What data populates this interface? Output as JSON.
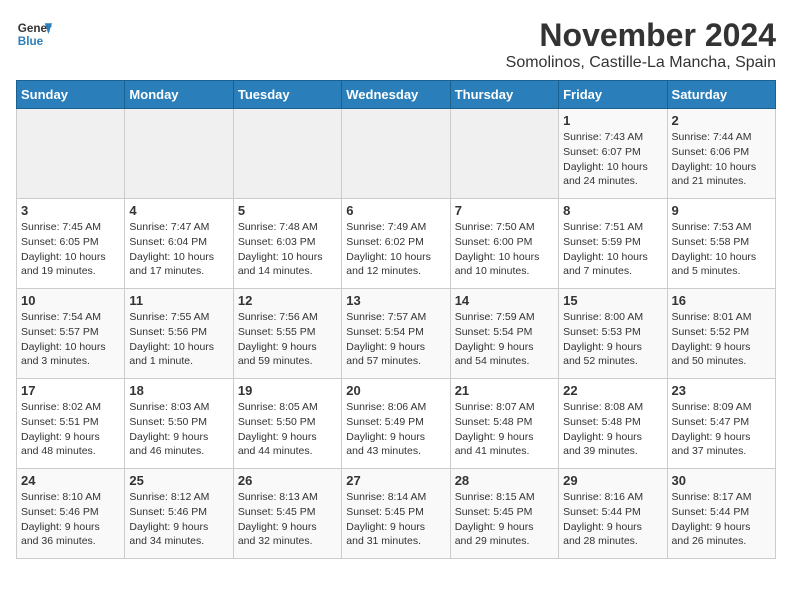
{
  "header": {
    "logo_general": "General",
    "logo_blue": "Blue",
    "month": "November 2024",
    "location": "Somolinos, Castille-La Mancha, Spain"
  },
  "weekdays": [
    "Sunday",
    "Monday",
    "Tuesday",
    "Wednesday",
    "Thursday",
    "Friday",
    "Saturday"
  ],
  "weeks": [
    [
      {
        "day": "",
        "info": ""
      },
      {
        "day": "",
        "info": ""
      },
      {
        "day": "",
        "info": ""
      },
      {
        "day": "",
        "info": ""
      },
      {
        "day": "",
        "info": ""
      },
      {
        "day": "1",
        "info": "Sunrise: 7:43 AM\nSunset: 6:07 PM\nDaylight: 10 hours\nand 24 minutes."
      },
      {
        "day": "2",
        "info": "Sunrise: 7:44 AM\nSunset: 6:06 PM\nDaylight: 10 hours\nand 21 minutes."
      }
    ],
    [
      {
        "day": "3",
        "info": "Sunrise: 7:45 AM\nSunset: 6:05 PM\nDaylight: 10 hours\nand 19 minutes."
      },
      {
        "day": "4",
        "info": "Sunrise: 7:47 AM\nSunset: 6:04 PM\nDaylight: 10 hours\nand 17 minutes."
      },
      {
        "day": "5",
        "info": "Sunrise: 7:48 AM\nSunset: 6:03 PM\nDaylight: 10 hours\nand 14 minutes."
      },
      {
        "day": "6",
        "info": "Sunrise: 7:49 AM\nSunset: 6:02 PM\nDaylight: 10 hours\nand 12 minutes."
      },
      {
        "day": "7",
        "info": "Sunrise: 7:50 AM\nSunset: 6:00 PM\nDaylight: 10 hours\nand 10 minutes."
      },
      {
        "day": "8",
        "info": "Sunrise: 7:51 AM\nSunset: 5:59 PM\nDaylight: 10 hours\nand 7 minutes."
      },
      {
        "day": "9",
        "info": "Sunrise: 7:53 AM\nSunset: 5:58 PM\nDaylight: 10 hours\nand 5 minutes."
      }
    ],
    [
      {
        "day": "10",
        "info": "Sunrise: 7:54 AM\nSunset: 5:57 PM\nDaylight: 10 hours\nand 3 minutes."
      },
      {
        "day": "11",
        "info": "Sunrise: 7:55 AM\nSunset: 5:56 PM\nDaylight: 10 hours\nand 1 minute."
      },
      {
        "day": "12",
        "info": "Sunrise: 7:56 AM\nSunset: 5:55 PM\nDaylight: 9 hours\nand 59 minutes."
      },
      {
        "day": "13",
        "info": "Sunrise: 7:57 AM\nSunset: 5:54 PM\nDaylight: 9 hours\nand 57 minutes."
      },
      {
        "day": "14",
        "info": "Sunrise: 7:59 AM\nSunset: 5:54 PM\nDaylight: 9 hours\nand 54 minutes."
      },
      {
        "day": "15",
        "info": "Sunrise: 8:00 AM\nSunset: 5:53 PM\nDaylight: 9 hours\nand 52 minutes."
      },
      {
        "day": "16",
        "info": "Sunrise: 8:01 AM\nSunset: 5:52 PM\nDaylight: 9 hours\nand 50 minutes."
      }
    ],
    [
      {
        "day": "17",
        "info": "Sunrise: 8:02 AM\nSunset: 5:51 PM\nDaylight: 9 hours\nand 48 minutes."
      },
      {
        "day": "18",
        "info": "Sunrise: 8:03 AM\nSunset: 5:50 PM\nDaylight: 9 hours\nand 46 minutes."
      },
      {
        "day": "19",
        "info": "Sunrise: 8:05 AM\nSunset: 5:50 PM\nDaylight: 9 hours\nand 44 minutes."
      },
      {
        "day": "20",
        "info": "Sunrise: 8:06 AM\nSunset: 5:49 PM\nDaylight: 9 hours\nand 43 minutes."
      },
      {
        "day": "21",
        "info": "Sunrise: 8:07 AM\nSunset: 5:48 PM\nDaylight: 9 hours\nand 41 minutes."
      },
      {
        "day": "22",
        "info": "Sunrise: 8:08 AM\nSunset: 5:48 PM\nDaylight: 9 hours\nand 39 minutes."
      },
      {
        "day": "23",
        "info": "Sunrise: 8:09 AM\nSunset: 5:47 PM\nDaylight: 9 hours\nand 37 minutes."
      }
    ],
    [
      {
        "day": "24",
        "info": "Sunrise: 8:10 AM\nSunset: 5:46 PM\nDaylight: 9 hours\nand 36 minutes."
      },
      {
        "day": "25",
        "info": "Sunrise: 8:12 AM\nSunset: 5:46 PM\nDaylight: 9 hours\nand 34 minutes."
      },
      {
        "day": "26",
        "info": "Sunrise: 8:13 AM\nSunset: 5:45 PM\nDaylight: 9 hours\nand 32 minutes."
      },
      {
        "day": "27",
        "info": "Sunrise: 8:14 AM\nSunset: 5:45 PM\nDaylight: 9 hours\nand 31 minutes."
      },
      {
        "day": "28",
        "info": "Sunrise: 8:15 AM\nSunset: 5:45 PM\nDaylight: 9 hours\nand 29 minutes."
      },
      {
        "day": "29",
        "info": "Sunrise: 8:16 AM\nSunset: 5:44 PM\nDaylight: 9 hours\nand 28 minutes."
      },
      {
        "day": "30",
        "info": "Sunrise: 8:17 AM\nSunset: 5:44 PM\nDaylight: 9 hours\nand 26 minutes."
      }
    ]
  ]
}
